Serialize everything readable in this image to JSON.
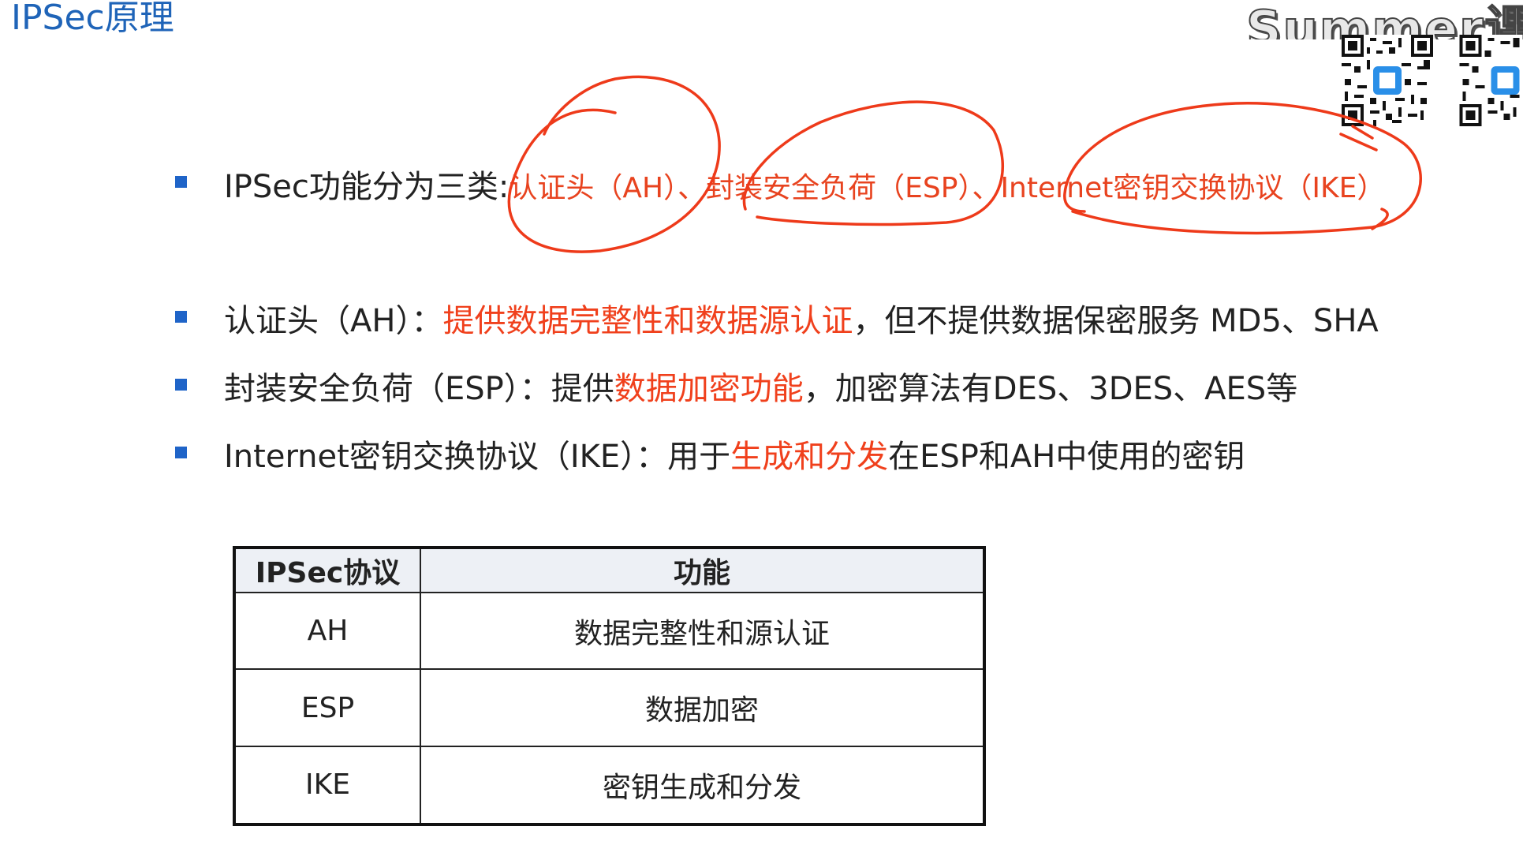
{
  "slide": {
    "title": "IPSec原理",
    "watermark": "Summer课"
  },
  "colors": {
    "title": "#1f64b8",
    "bullet": "#1f64c8",
    "highlight": "#f0401c",
    "annotation": "#ee3a1a"
  },
  "line1": {
    "prefix": "IPSec功能分为三类:",
    "ah": "认证头（AH）",
    "sep1": "、",
    "esp": "封装安全负荷（ESP）",
    "sep2": "、",
    "ike": "Internet密钥交换协议（IKE）"
  },
  "line2": {
    "prefix": "认证头（AH）：",
    "highlight": "提供数据完整性和数据源认证",
    "suffix": "，但不提供数据保密服务 MD5、SHA"
  },
  "line3": {
    "prefix": "封装安全负荷（ESP）：提供",
    "highlight": "数据加密功能",
    "suffix": "，加密算法有DES、3DES、AES等"
  },
  "line4": {
    "prefix": "Internet密钥交换协议（IKE）：用于",
    "highlight": "生成和分发",
    "suffix": "在ESP和AH中使用的密钥"
  },
  "table": {
    "headers": [
      "IPSec协议",
      "功能"
    ],
    "rows": [
      [
        "AH",
        "数据完整性和源认证"
      ],
      [
        "ESP",
        "数据加密"
      ],
      [
        "IKE",
        "密钥生成和分发"
      ]
    ]
  }
}
